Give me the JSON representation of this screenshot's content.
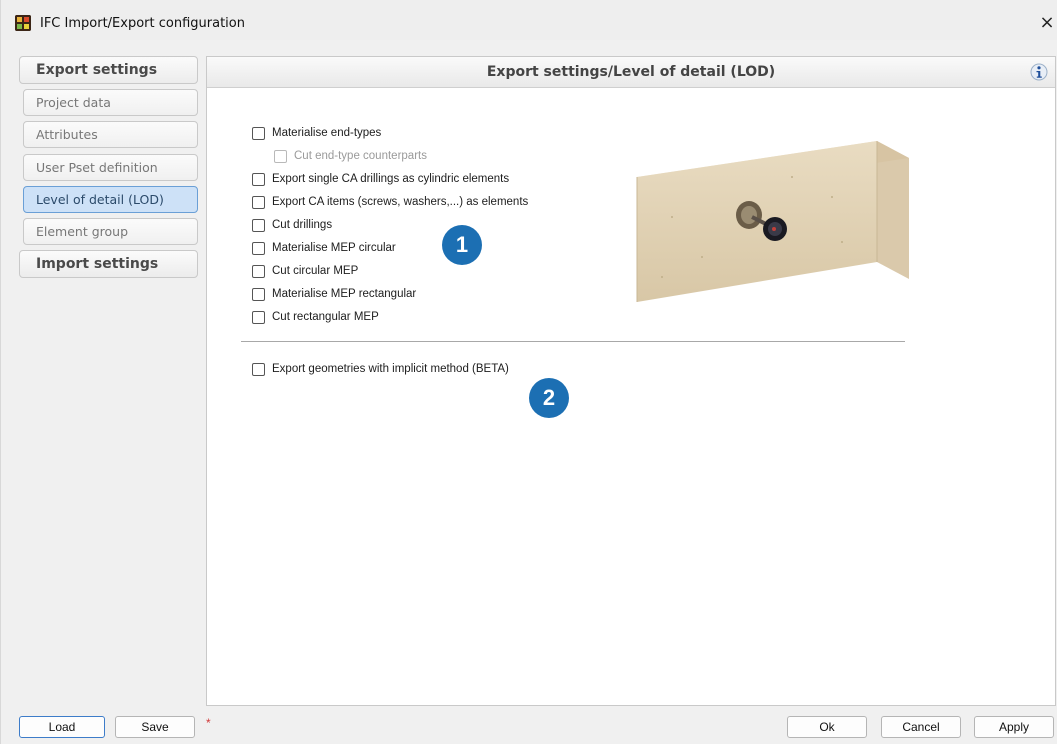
{
  "window": {
    "title": "IFC Import/Export configuration",
    "close_glyph": "×"
  },
  "sidebar": {
    "export_header": "Export settings",
    "items": [
      {
        "label": "Project data"
      },
      {
        "label": "Attributes"
      },
      {
        "label": "User Pset definition"
      },
      {
        "label": "Level of detail (LOD)",
        "active": true
      },
      {
        "label": "Element group"
      }
    ],
    "import_header": "Import settings"
  },
  "panel": {
    "title": "Export settings/Level of detail (LOD)",
    "info_icon": "info-icon",
    "options": [
      {
        "label": "Materialise end-types",
        "checked": false
      },
      {
        "label": "Cut end-type counterparts",
        "checked": false,
        "disabled": true
      },
      {
        "label": "Export single CA drillings as cylindric elements",
        "checked": false
      },
      {
        "label": "Export CA items (screws, washers,...) as elements",
        "checked": false
      },
      {
        "label": "Cut drillings",
        "checked": false
      },
      {
        "label": "Materialise MEP circular",
        "checked": false
      },
      {
        "label": "Cut circular MEP",
        "checked": false
      },
      {
        "label": "Materialise MEP rectangular",
        "checked": false
      },
      {
        "label": "Cut rectangular MEP",
        "checked": false
      }
    ],
    "implicit_option": {
      "label": "Export geometries with implicit method (BETA)",
      "checked": false
    },
    "badges": [
      "1",
      "2"
    ]
  },
  "footer": {
    "load": "Load",
    "save": "Save",
    "modified_marker": "*",
    "ok": "Ok",
    "cancel": "Cancel",
    "apply": "Apply"
  },
  "colors": {
    "badge": "#1c6fb3",
    "active_item": "#cde1f7",
    "active_border": "#6a9fd6"
  }
}
